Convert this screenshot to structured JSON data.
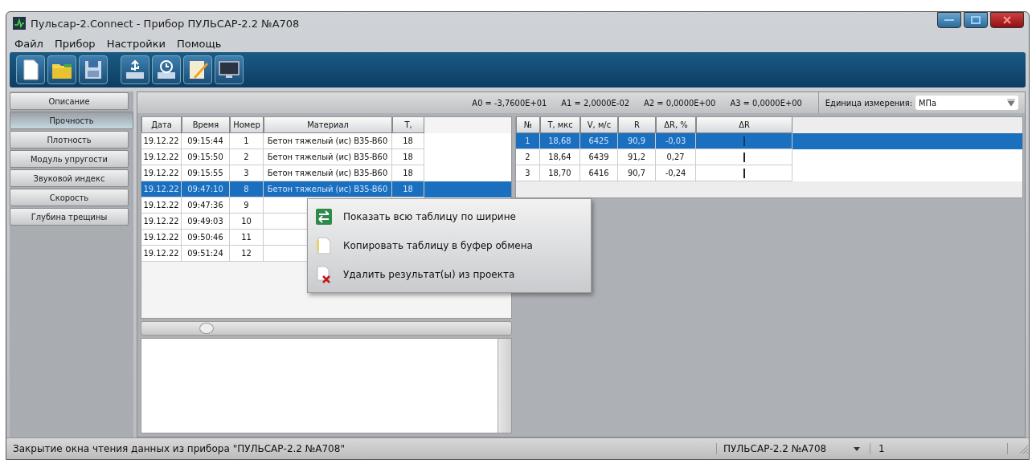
{
  "window": {
    "title": "Пульсар-2.Connect - Прибор ПУЛЬСАР-2.2 №А708"
  },
  "menu": [
    "Файл",
    "Прибор",
    "Настройки",
    "Помощь"
  ],
  "toolbar": [
    {
      "kind": "new"
    },
    {
      "kind": "open"
    },
    {
      "kind": "save"
    },
    {
      "kind": "usb"
    },
    {
      "kind": "history"
    },
    {
      "kind": "edit"
    },
    {
      "kind": "monitor"
    }
  ],
  "sidebar": {
    "items": [
      {
        "label": "Описание",
        "selected": false
      },
      {
        "label": "Прочность",
        "selected": true
      },
      {
        "label": "Плотность",
        "selected": false
      },
      {
        "label": "Модуль упругости",
        "selected": false
      },
      {
        "label": "Звуковой индекс",
        "selected": false
      },
      {
        "label": "Скорость",
        "selected": false
      },
      {
        "label": "Глубина трещины",
        "selected": false
      }
    ]
  },
  "coefficients": [
    "A0 = -3,7600E+01",
    "A1 = 2,0000E-02",
    "A2 = 0,0000E+00",
    "A3 = 0,0000E+00"
  ],
  "unit": {
    "label": "Единица измерения:",
    "value": "МПа"
  },
  "results_table": {
    "columns": [
      "Дата",
      "Время",
      "Номер",
      "Материал",
      "T,"
    ],
    "rows": [
      {
        "cells": [
          "19.12.22",
          "09:15:44",
          "1",
          "Бетон тяжелый (ис) B35-B60",
          "18"
        ],
        "selected": false
      },
      {
        "cells": [
          "19.12.22",
          "09:15:50",
          "2",
          "Бетон тяжелый (ис) B35-B60",
          "18"
        ],
        "selected": false
      },
      {
        "cells": [
          "19.12.22",
          "09:15:55",
          "3",
          "Бетон тяжелый (ис) B35-B60",
          "18"
        ],
        "selected": false
      },
      {
        "cells": [
          "19.12.22",
          "09:47:10",
          "8",
          "Бетон тяжелый (ис) B35-B60",
          "18"
        ],
        "selected": true
      },
      {
        "cells": [
          "19.12.22",
          "09:47:36",
          "9",
          "",
          ""
        ],
        "selected": false
      },
      {
        "cells": [
          "19.12.22",
          "09:49:03",
          "10",
          "",
          ""
        ],
        "selected": false
      },
      {
        "cells": [
          "19.12.22",
          "09:50:46",
          "11",
          "",
          ""
        ],
        "selected": false
      },
      {
        "cells": [
          "19.12.22",
          "09:51:24",
          "12",
          "",
          ""
        ],
        "selected": false
      }
    ]
  },
  "measurements_table": {
    "columns": [
      "№",
      "T, мкс",
      "V, м/с",
      "R",
      "ΔR, %",
      "ΔR"
    ],
    "rows": [
      {
        "cells": [
          "1",
          "18,68",
          "6425",
          "90,9",
          "-0,03"
        ],
        "selected": true
      },
      {
        "cells": [
          "2",
          "18,64",
          "6439",
          "91,2",
          "0,27"
        ],
        "selected": false
      },
      {
        "cells": [
          "3",
          "18,70",
          "6416",
          "90,7",
          "-0,24"
        ],
        "selected": false
      }
    ]
  },
  "context_menu": [
    {
      "kind": "fit",
      "label": "Показать всю таблицу по ширине"
    },
    {
      "kind": "copy",
      "label": "Копировать таблицу в буфер обмена"
    },
    {
      "kind": "delete",
      "label": "Удалить результат(ы) из проекта"
    }
  ],
  "status_bar": {
    "message": "Закрытие окна чтения данных из прибора \"ПУЛЬСАР-2.2 №А708\"",
    "device": "ПУЛЬСАР-2.2 №А708",
    "count": "1"
  }
}
